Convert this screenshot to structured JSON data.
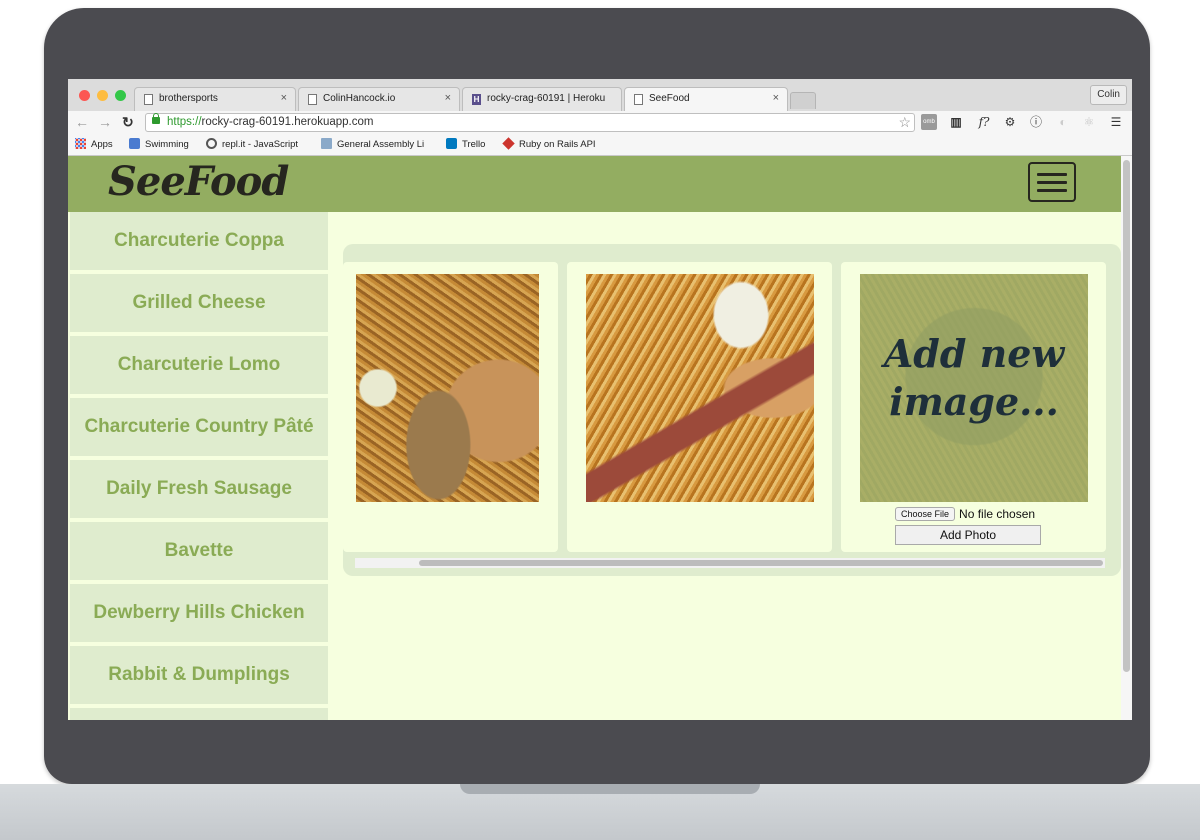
{
  "browser": {
    "tabs": [
      {
        "title": "brothersports",
        "close": "×"
      },
      {
        "title": "ColinHancock.io",
        "close": "×"
      },
      {
        "title": "rocky-crag-60191 | Heroku",
        "close": "×"
      },
      {
        "title": "SeeFood",
        "close": "×"
      }
    ],
    "profile": "Colin",
    "url_scheme": "https://",
    "url_host": "rocky-crag-60191.herokuapp.com",
    "bookmarks": [
      {
        "label": "Apps",
        "icon": "apps-icon"
      },
      {
        "label": "Swimming",
        "icon": "swimming-icon"
      },
      {
        "label": "repl.it - JavaScript",
        "icon": "repl-icon"
      },
      {
        "label": "General Assembly Li",
        "icon": "folder-icon"
      },
      {
        "label": "Trello",
        "icon": "trello-icon"
      },
      {
        "label": "Ruby on Rails API",
        "icon": "ruby-icon"
      }
    ]
  },
  "header": {
    "logo": "SeeFood",
    "menu_icon": "hamburger-menu-icon",
    "color": "#93ad61"
  },
  "sidebar": {
    "items": [
      "Charcuterie Coppa",
      "Grilled Cheese",
      "Charcuterie Lomo",
      "Charcuterie Country Pâté",
      "Daily Fresh Sausage",
      "Bavette",
      "Dewberry Hills Chicken",
      "Rabbit & Dumplings"
    ],
    "text_color": "#8aab55",
    "bg_color": "#dfecce"
  },
  "gallery": {
    "photos": [
      {
        "alt": "fries-sausage-bread-photo"
      },
      {
        "alt": "sausage-fries-platter-photo"
      }
    ],
    "add_card": {
      "caption": "Add new image...",
      "choose_file": "Choose File",
      "file_status": "No file chosen",
      "submit": "Add Photo"
    }
  }
}
